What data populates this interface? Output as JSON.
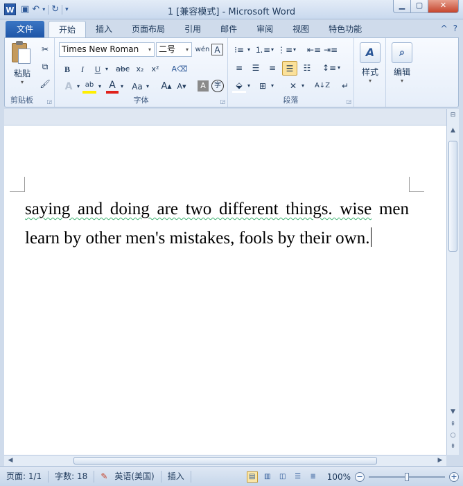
{
  "window": {
    "title": "1 [兼容模式]  -  Microsoft Word",
    "app_icon_letter": "W"
  },
  "tabs": [
    {
      "label": "文件"
    },
    {
      "label": "开始"
    },
    {
      "label": "插入"
    },
    {
      "label": "页面布局"
    },
    {
      "label": "引用"
    },
    {
      "label": "邮件"
    },
    {
      "label": "审阅"
    },
    {
      "label": "视图"
    },
    {
      "label": "特色功能"
    }
  ],
  "ribbon": {
    "clipboard": {
      "label": "剪贴板",
      "paste_label": "粘贴"
    },
    "font": {
      "label": "字体",
      "font_name": "Times New Roman",
      "font_size": "二号"
    },
    "paragraph": {
      "label": "段落"
    },
    "styles_label": "样式",
    "editing_label": "编辑"
  },
  "document": {
    "text_part1": "saying and doing are two different things. ",
    "text_squiggle": "wise",
    "text_part2": " men learn by other men's mistakes, fools by their own."
  },
  "status": {
    "page": "页面: 1/1",
    "words": "字数: 18",
    "language": "英语(美国)",
    "mode": "插入",
    "zoom": "100%"
  },
  "colors": {
    "accent": "#2b5797",
    "file_tab": "#1f56a8",
    "close_button": "#c5442c"
  }
}
